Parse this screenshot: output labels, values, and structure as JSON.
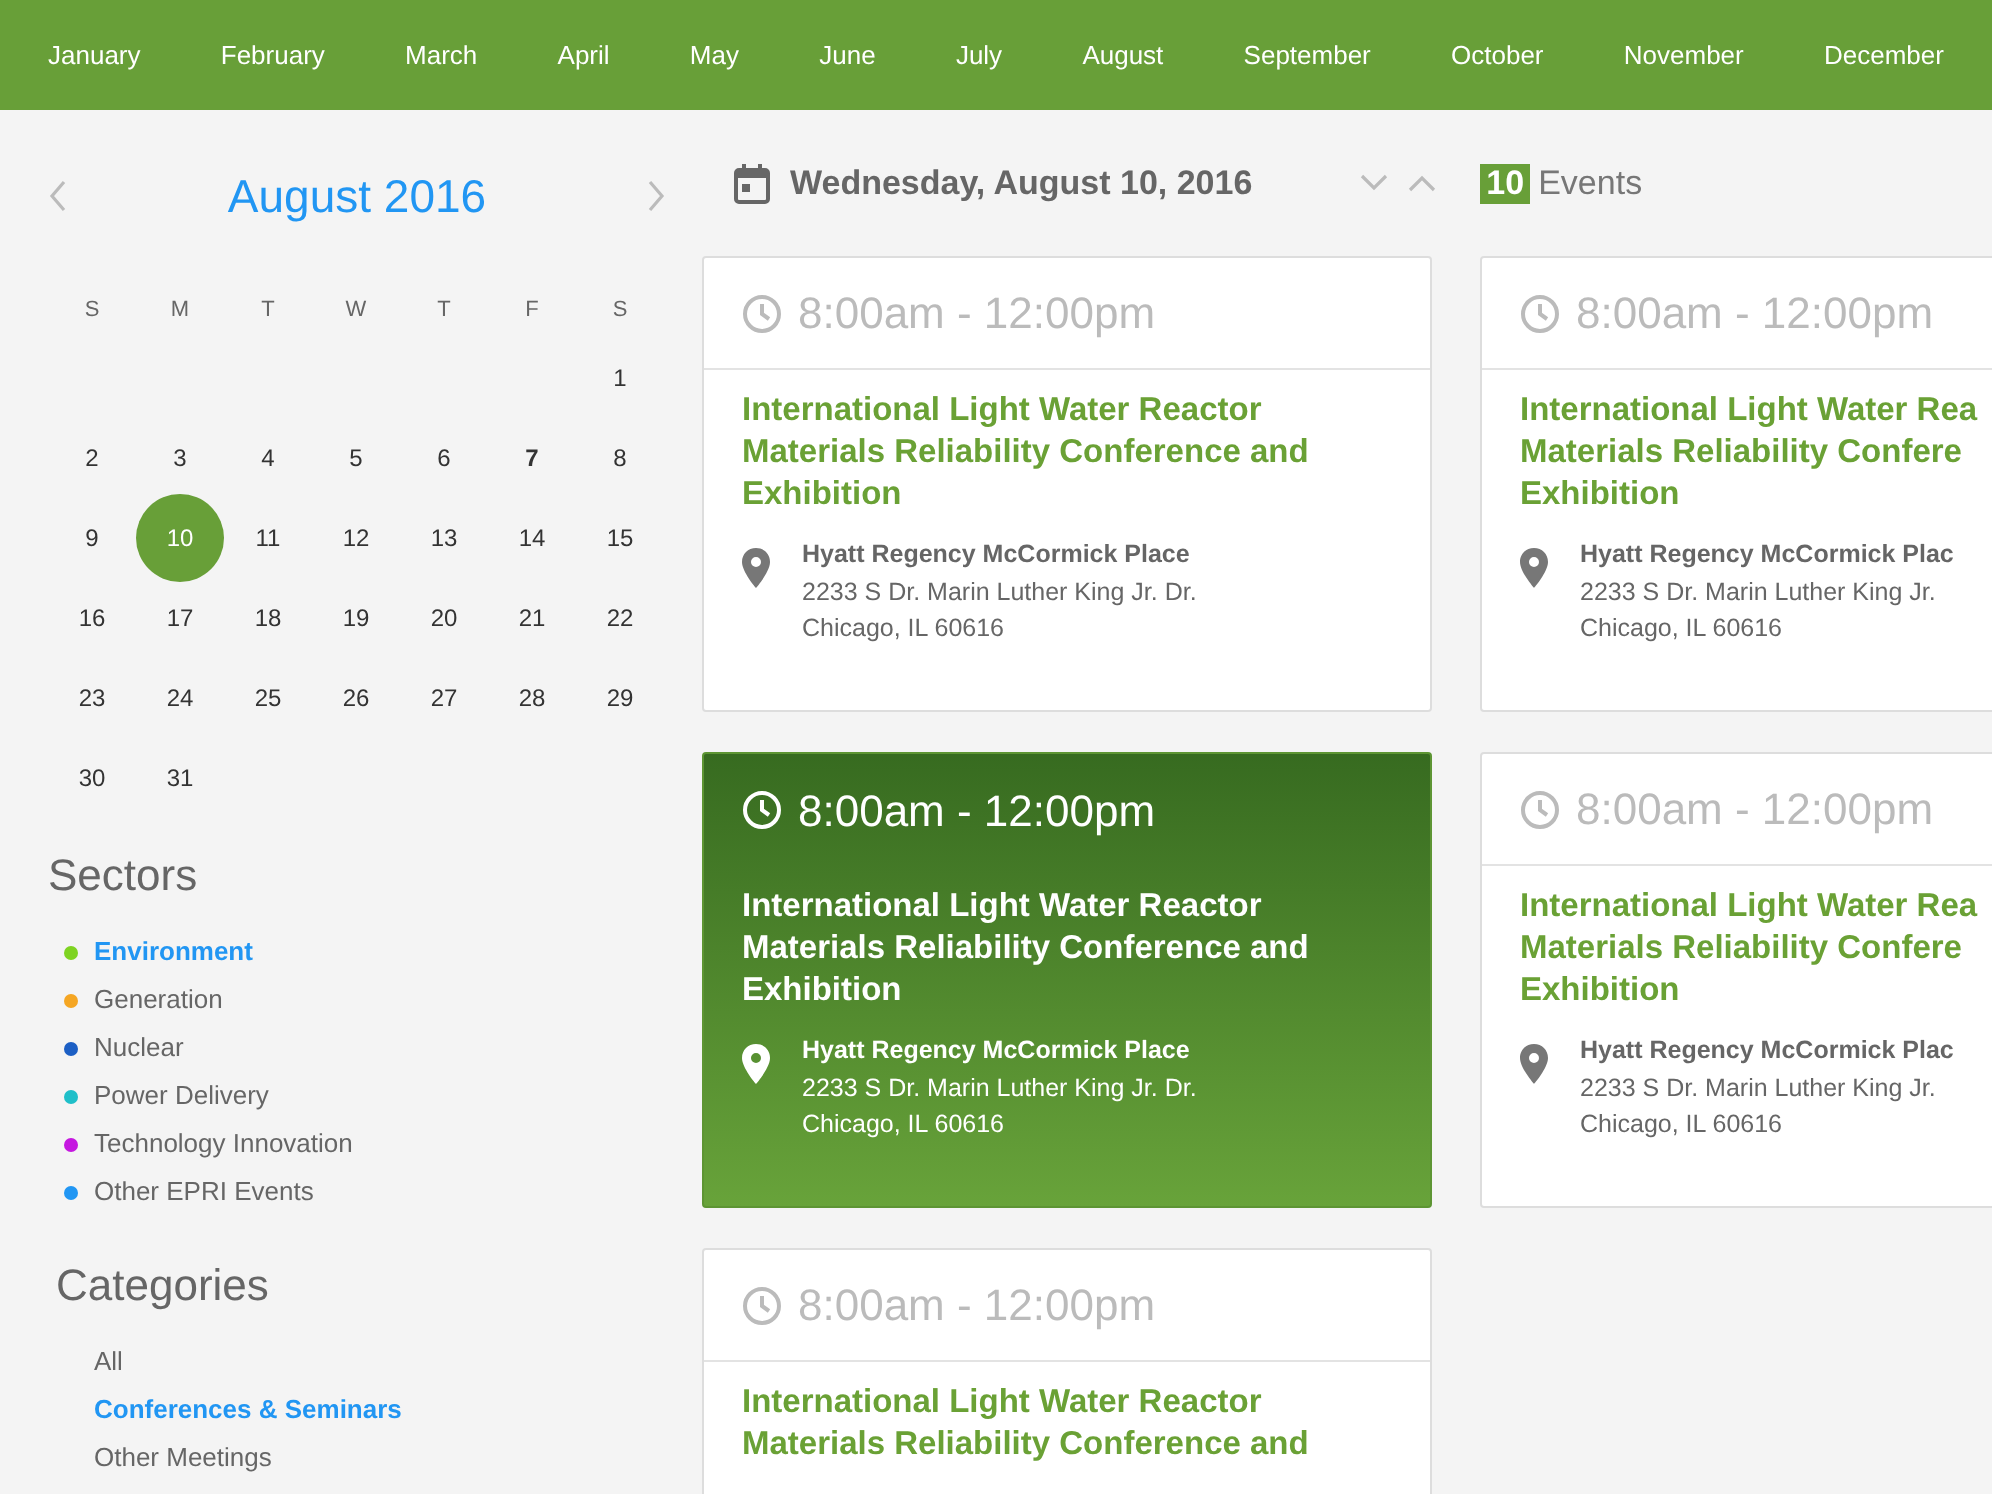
{
  "months": [
    "January",
    "February",
    "March",
    "April",
    "May",
    "June",
    "July",
    "August",
    "September",
    "October",
    "November",
    "December"
  ],
  "calendar": {
    "title": "August 2016",
    "weekdays": [
      "S",
      "M",
      "T",
      "W",
      "T",
      "F",
      "S"
    ],
    "weeks": [
      {
        "days": [
          {
            "day": "1",
            "selected": false,
            "today": false
          }
        ]
      },
      {
        "days": [
          {
            "day": "2",
            "selected": false,
            "today": false
          },
          {
            "day": "3",
            "selected": false,
            "today": false
          },
          {
            "day": "4",
            "selected": false,
            "today": false
          },
          {
            "day": "5",
            "selected": false,
            "today": false
          },
          {
            "day": "6",
            "selected": false,
            "today": false
          },
          {
            "day": "7",
            "selected": false,
            "today": true
          },
          {
            "day": "8",
            "selected": false,
            "today": false
          }
        ]
      },
      {
        "days": [
          {
            "day": "9",
            "selected": false,
            "today": false
          },
          {
            "day": "10",
            "selected": true,
            "today": false
          },
          {
            "day": "11",
            "selected": false,
            "today": false
          },
          {
            "day": "12",
            "selected": false,
            "today": false
          },
          {
            "day": "13",
            "selected": false,
            "today": false
          },
          {
            "day": "14",
            "selected": false,
            "today": false
          },
          {
            "day": "15",
            "selected": false,
            "today": false
          }
        ]
      },
      {
        "days": [
          {
            "day": "16",
            "selected": false,
            "today": false
          },
          {
            "day": "17",
            "selected": false,
            "today": false
          },
          {
            "day": "18",
            "selected": false,
            "today": false
          },
          {
            "day": "19",
            "selected": false,
            "today": false
          },
          {
            "day": "20",
            "selected": false,
            "today": false
          },
          {
            "day": "21",
            "selected": false,
            "today": false
          },
          {
            "day": "22",
            "selected": false,
            "today": false
          }
        ]
      },
      {
        "days": [
          {
            "day": "23",
            "selected": false,
            "today": false
          },
          {
            "day": "24",
            "selected": false,
            "today": false
          },
          {
            "day": "25",
            "selected": false,
            "today": false
          },
          {
            "day": "26",
            "selected": false,
            "today": false
          },
          {
            "day": "27",
            "selected": false,
            "today": false
          },
          {
            "day": "28",
            "selected": false,
            "today": false
          },
          {
            "day": "29",
            "selected": false,
            "today": false
          }
        ]
      },
      {
        "days": [
          {
            "day": "30",
            "selected": false,
            "today": false
          },
          {
            "day": "31",
            "selected": false,
            "today": false
          }
        ]
      }
    ]
  },
  "sectors": {
    "title": "Sectors",
    "items": [
      {
        "label": "Environment",
        "color": "#7ed321",
        "selected": true
      },
      {
        "label": "Generation",
        "color": "#f5a623",
        "selected": false
      },
      {
        "label": "Nuclear",
        "color": "#1c5fc4",
        "selected": false
      },
      {
        "label": "Power Delivery",
        "color": "#1fbfc9",
        "selected": false
      },
      {
        "label": "Technology Innovation",
        "color": "#c517e0",
        "selected": false
      },
      {
        "label": "Other EPRI Events",
        "color": "#2196f3",
        "selected": false
      }
    ]
  },
  "categories": {
    "title": "Categories",
    "items": [
      {
        "label": "All",
        "selected": false
      },
      {
        "label": "Conferences & Seminars",
        "selected": true
      },
      {
        "label": "Other Meetings",
        "selected": false
      }
    ]
  },
  "day_header": {
    "date": "Wednesday, August 10, 2016",
    "count": "10",
    "count_label": "Events"
  },
  "columns": [
    {
      "events": [
        {
          "time": "8:00am - 12:00pm",
          "title_lines": [
            "International Light Water Reactor",
            "Materials Reliability Conference and",
            "Exhibition"
          ],
          "venue": "Hyatt Regency McCormick Place",
          "address_lines": [
            "2233 S Dr. Marin Luther King Jr. Dr.",
            "Chicago, IL 60616"
          ],
          "selected": false
        },
        {
          "time": "8:00am - 12:00pm",
          "title_lines": [
            "International Light Water Reactor",
            "Materials Reliability Conference and",
            "Exhibition"
          ],
          "venue": "Hyatt Regency McCormick Place",
          "address_lines": [
            "2233 S Dr. Marin Luther King Jr. Dr.",
            "Chicago, IL 60616"
          ],
          "selected": true
        },
        {
          "time": "8:00am - 12:00pm",
          "title_lines": [
            "International Light Water Reactor",
            "Materials Reliability Conference and"
          ],
          "selected": false
        }
      ]
    },
    {
      "events": [
        {
          "time": "8:00am - 12:00pm",
          "title_lines": [
            "International Light Water Rea",
            "Materials Reliability Confere",
            "Exhibition"
          ],
          "venue": "Hyatt Regency McCormick Plac",
          "address_lines": [
            "2233 S Dr. Marin Luther King Jr.",
            "Chicago, IL 60616"
          ],
          "selected": false
        },
        {
          "time": "8:00am - 12:00pm",
          "title_lines": [
            "International Light Water Rea",
            "Materials Reliability Confere",
            "Exhibition"
          ],
          "venue": "Hyatt Regency McCormick Plac",
          "address_lines": [
            "2233 S Dr. Marin Luther King Jr.",
            "Chicago, IL 60616"
          ],
          "selected": false
        }
      ]
    }
  ]
}
